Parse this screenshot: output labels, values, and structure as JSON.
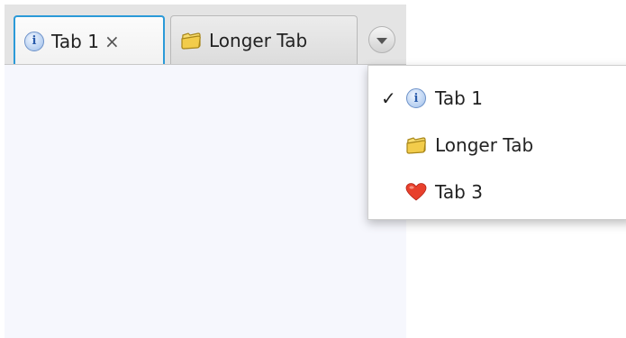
{
  "tabs": [
    {
      "label": "Tab 1",
      "icon": "info-icon",
      "selected": true,
      "close_glyph": "×"
    },
    {
      "label": "Longer Tab",
      "icon": "folder-icon",
      "selected": false
    }
  ],
  "overflow_button": {
    "icon": "chevron-down-icon"
  },
  "menu": {
    "items": [
      {
        "label": "Tab 1",
        "icon": "info-icon",
        "checked": true,
        "check_glyph": "✓"
      },
      {
        "label": "Longer Tab",
        "icon": "folder-icon",
        "checked": false
      },
      {
        "label": "Tab 3",
        "icon": "heart-icon",
        "checked": false
      }
    ]
  },
  "icons": {
    "info_glyph": "i"
  },
  "colors": {
    "selected_tab_border": "#2b9ad8",
    "content_background": "#f6f7fd",
    "header_background": "#e4e4e4",
    "heart": "#e8402c",
    "folder": "#f2cc4b"
  }
}
